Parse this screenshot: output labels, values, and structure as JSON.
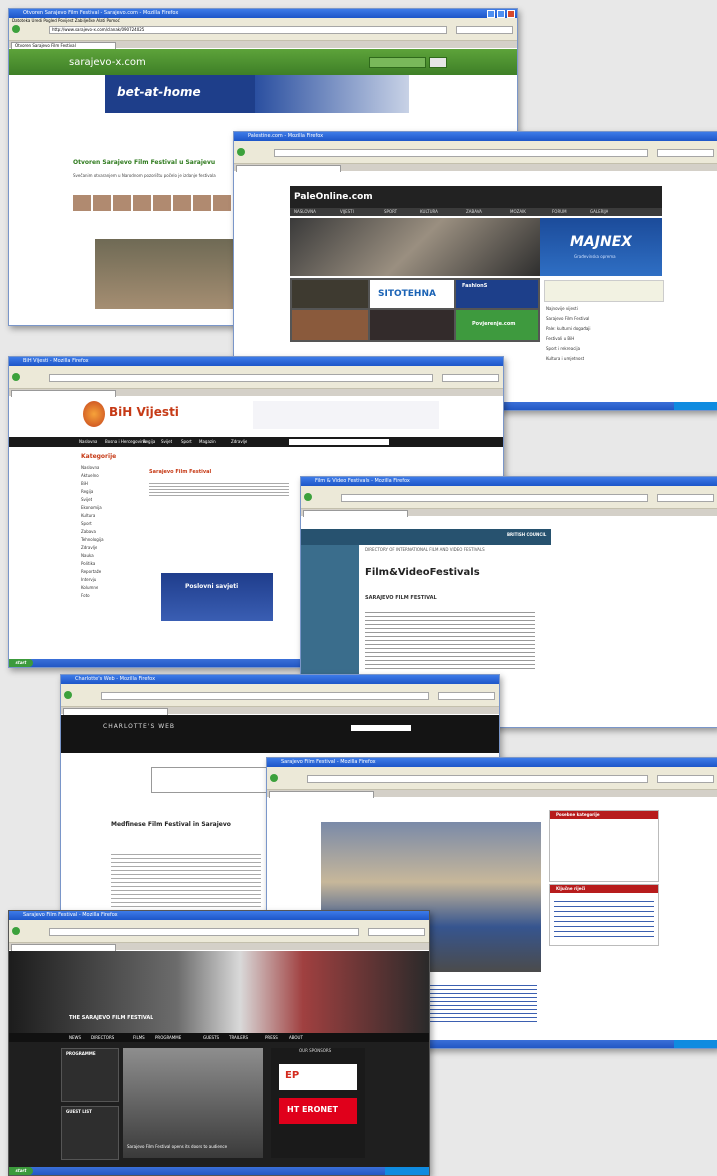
{
  "taskbar": {
    "start_label": "start"
  },
  "win1": {
    "title": "Otvoren Sarajevo Film Festival - Sarajevo.com - Mozilla Firefox",
    "menu": "Datoteka  Uredi  Pogled  Povijest  Zabilješke  Alati  Pomoć",
    "address": "http://www.sarajevo-x.com/clanak/090724025",
    "tab": "Otvoren Sarajevo Film Festival",
    "logo": "sarajevo-x.com",
    "banner_text": "bet-at-home",
    "headline": "Otvoren Sarajevo Film Festival u Sarajevu",
    "body": "Svečanim otvaranjem u Narodnom pozorištu počelo je izdanje festivala"
  },
  "win2": {
    "title": "Palestine.com - Mozilla Firefox",
    "logo": "PaleOnline.com",
    "nav_items": [
      "NASLOVNA",
      "VIJESTI",
      "SPORT",
      "KULTURA",
      "ZABAVA",
      "MOZAIK",
      "FORUM",
      "GALERIJA"
    ],
    "ad_text": "MAJNEX",
    "ad_sub": "Građevinska oprema",
    "sponsor1": "SITOTEHNA",
    "sponsor2": "FashionS",
    "sponsor3": "Povjerenje.com",
    "sidebar_items": [
      "Najnovije vijesti",
      "Sarajevo Film Festival",
      "Pale: kulturni događaji",
      "Festivali u BiH",
      "Sport i rekreacija",
      "Kultura i umjetnost"
    ]
  },
  "win3": {
    "title": "BiH Vijesti - Mozilla Firefox",
    "logo": "BiH Vijesti",
    "nav_items": [
      "Naslovna",
      "Bosna i Hercegovina",
      "Regija",
      "Svijet",
      "Sport",
      "Magazin",
      "Zdravlje"
    ],
    "sidebar_title": "Kategorije",
    "sidebar_items": [
      "Naslovna",
      "Aktuelno",
      "BiH",
      "Regija",
      "Svijet",
      "Ekonomija",
      "Kultura",
      "Sport",
      "Zabava",
      "Tehnologija",
      "Zdravlje",
      "Nauka",
      "Politika",
      "Reportaže",
      "Intervju",
      "Kolumne",
      "Foto"
    ],
    "headline": "Sarajevo Film Festival",
    "ad_text": "Poslovni savjeti"
  },
  "win4": {
    "title": "Film & Video Festivals - Mozilla Firefox",
    "logo": "BRITISH COUNCIL",
    "heading": "Film&VideoFestivals",
    "subheading": "DIRECTORY OF INTERNATIONAL FILM AND VIDEO FESTIVALS",
    "entry": "SARAJEVO FILM FESTIVAL"
  },
  "win5": {
    "title": "Charlotte's Web - Mozilla Firefox",
    "logo": "CHARLOTTE'S WEB",
    "headline": "Medfinese Film Festival in Sarajevo"
  },
  "win6": {
    "title": "Sarajevo Film Festival - Mozilla Firefox",
    "caption": "Sarajevo Film Festival",
    "box1": "Posebne kategorije",
    "box2": "Ključne riječi"
  },
  "win7": {
    "title": "Sarajevo Film Festival - Mozilla Firefox",
    "overlay": "THE SARAJEVO FILM FESTIVAL",
    "nav_items": [
      "NEWS",
      "DIRECTORS",
      "FILMS",
      "PROGRAMME",
      "GUESTS",
      "TRAILERS",
      "PRESS",
      "ABOUT"
    ],
    "section1": "PROGRAMME",
    "section2": "GUEST LIST",
    "news_text": "Sarajevo Film Festival opens its doors to audience",
    "sponsor_label": "OUR SPONSORS",
    "sponsor1": "EP",
    "sponsor2": "HT ERONET"
  }
}
